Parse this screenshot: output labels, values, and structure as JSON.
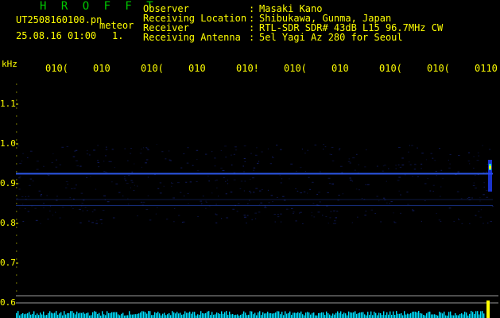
{
  "header": {
    "brand": "H R O F F T",
    "filename": "UT2508160100.pn",
    "mode": "meteor",
    "datetime": "25.08.16 01:00",
    "index": "1."
  },
  "info": [
    {
      "label": "Observer",
      "value": "Masaki Kano"
    },
    {
      "label": "Receiving Location",
      "value": "Shibukawa, Gunma, Japan"
    },
    {
      "label": "Receiver",
      "value": "RTL-SDR SDR# 43dB L15 96.7MHz CW"
    },
    {
      "label": "Receiving Antenna",
      "value": "5el Yagi Az 280 for Seoul"
    }
  ],
  "chart_data": {
    "type": "heatmap",
    "ylabel": "kHz",
    "y_ticks": [
      "1.1",
      "1.0",
      "0.9",
      "0.8",
      "0.7",
      "0.6"
    ],
    "x_ticks": [
      "010(",
      "010",
      "010(",
      "010",
      "010!",
      "010(",
      "010",
      "010(",
      "010(",
      "0110"
    ],
    "ylim": [
      0.6,
      1.15
    ],
    "signal_bands_khz": [
      0.925,
      0.845
    ],
    "colors": {
      "text": "#ffff00",
      "signal": "#3060ff",
      "noise": "#00e0ff",
      "brand": "#00c800"
    }
  }
}
